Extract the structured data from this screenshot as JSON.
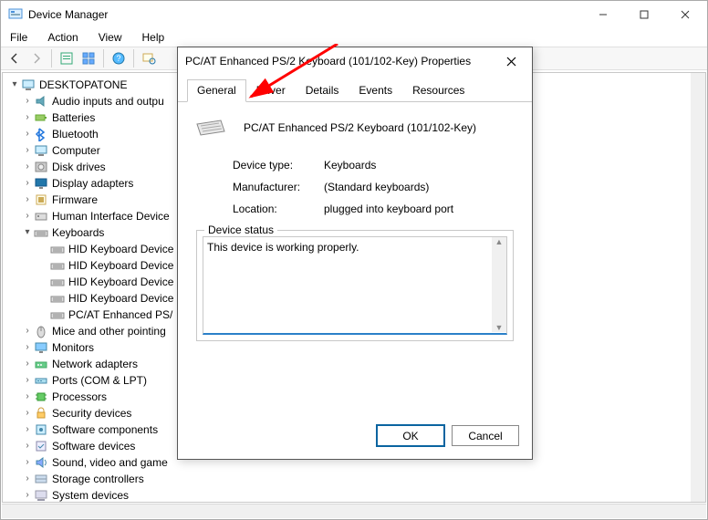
{
  "window": {
    "title": "Device Manager",
    "menu": [
      "File",
      "Action",
      "View",
      "Help"
    ]
  },
  "tree": {
    "root": "DESKTOPATONE",
    "items": [
      {
        "label": "Audio inputs and outpu",
        "exp": false,
        "icon": "audio"
      },
      {
        "label": "Batteries",
        "exp": false,
        "icon": "battery"
      },
      {
        "label": "Bluetooth",
        "exp": false,
        "icon": "bluetooth"
      },
      {
        "label": "Computer",
        "exp": false,
        "icon": "computer"
      },
      {
        "label": "Disk drives",
        "exp": false,
        "icon": "disk"
      },
      {
        "label": "Display adapters",
        "exp": false,
        "icon": "display"
      },
      {
        "label": "Firmware",
        "exp": false,
        "icon": "firmware"
      },
      {
        "label": "Human Interface Device",
        "exp": false,
        "icon": "hid"
      },
      {
        "label": "Keyboards",
        "exp": true,
        "icon": "keyboard",
        "children": [
          {
            "label": "HID Keyboard Device"
          },
          {
            "label": "HID Keyboard Device"
          },
          {
            "label": "HID Keyboard Device"
          },
          {
            "label": "HID Keyboard Device"
          },
          {
            "label": "PC/AT Enhanced PS/"
          }
        ]
      },
      {
        "label": "Mice and other pointing",
        "exp": false,
        "icon": "mouse"
      },
      {
        "label": "Monitors",
        "exp": false,
        "icon": "monitor"
      },
      {
        "label": "Network adapters",
        "exp": false,
        "icon": "network"
      },
      {
        "label": "Ports (COM & LPT)",
        "exp": false,
        "icon": "port"
      },
      {
        "label": "Processors",
        "exp": false,
        "icon": "cpu"
      },
      {
        "label": "Security devices",
        "exp": false,
        "icon": "security"
      },
      {
        "label": "Software components",
        "exp": false,
        "icon": "swcomp"
      },
      {
        "label": "Software devices",
        "exp": false,
        "icon": "swdev"
      },
      {
        "label": "Sound, video and game",
        "exp": false,
        "icon": "sound"
      },
      {
        "label": "Storage controllers",
        "exp": false,
        "icon": "storage"
      },
      {
        "label": "System devices",
        "exp": false,
        "icon": "system"
      }
    ]
  },
  "dialog": {
    "title": "PC/AT Enhanced PS/2 Keyboard (101/102-Key) Properties",
    "tabs": [
      "General",
      "Driver",
      "Details",
      "Events",
      "Resources"
    ],
    "active_tab": 0,
    "device_name": "PC/AT Enhanced PS/2 Keyboard (101/102-Key)",
    "type_label": "Device type:",
    "type_value": "Keyboards",
    "mfg_label": "Manufacturer:",
    "mfg_value": "(Standard keyboards)",
    "loc_label": "Location:",
    "loc_value": "plugged into keyboard port",
    "status_group": "Device status",
    "status_text": "This device is working properly.",
    "ok": "OK",
    "cancel": "Cancel"
  }
}
